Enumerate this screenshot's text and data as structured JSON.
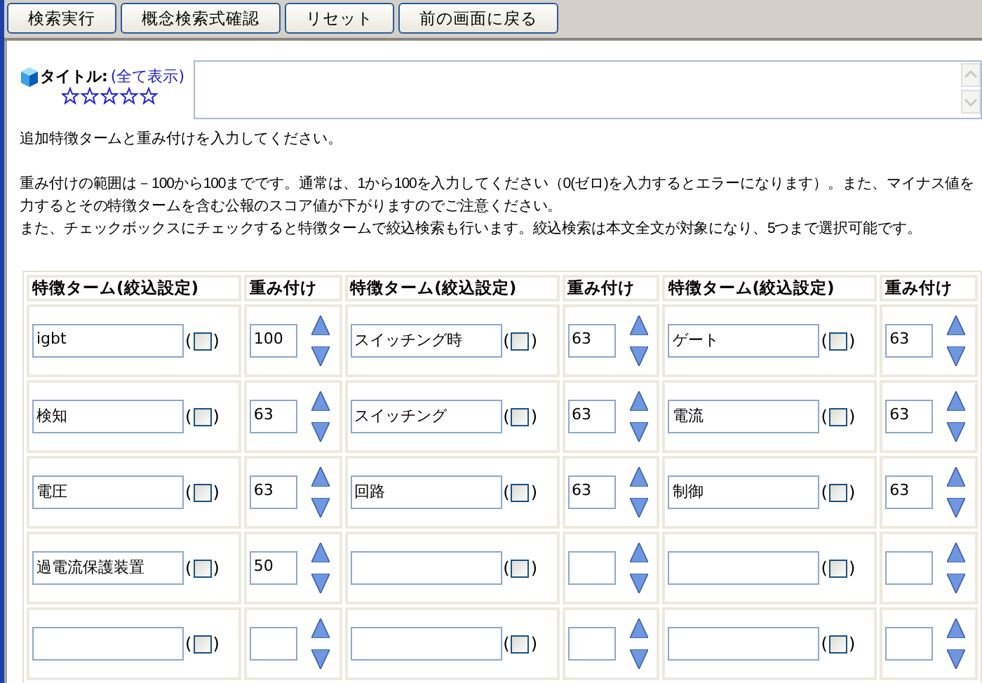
{
  "toolbar": {
    "buttons": [
      "検索実行",
      "概念検索式確認",
      "リセット",
      "前の画面に戻る"
    ]
  },
  "title_row": {
    "label": "タイトル:",
    "link": "(全て表示)",
    "stars": 0
  },
  "instructions": [
    "追加特徴タームと重み付けを入力してください。",
    "重み付けの範囲は－100から100までです。通常は、1から100を入力してください（0(ゼロ)を入力するとエラーになります）。また、マイナス値を",
    "力するとその特徴タームを含む公報のスコア値が下がりますのでご注意ください。",
    "また、チェックボックスにチェックすると特徴タームで絞込検索も行います。絞込検索は本文全文が対象になり、5つまで選択可能です。"
  ],
  "table": {
    "columns": [
      "特徴ターム(絞込設定)",
      "重み付け",
      "特徴ターム(絞込設定)",
      "重み付け",
      "特徴ターム(絞込設定)",
      "重み付け"
    ],
    "rows": [
      {
        "cells": [
          {
            "kind": "term",
            "term": "igbt",
            "open": "(",
            "checked": false,
            "close": ")"
          },
          {
            "kind": "weight",
            "weight": "100"
          },
          {
            "kind": "term",
            "term": "スイッチング時",
            "open": "(",
            "checked": false,
            "close": ")"
          },
          {
            "kind": "weight",
            "weight": "63"
          },
          {
            "kind": "term",
            "term": "ゲート",
            "open": "(",
            "checked": false,
            "close": ")"
          },
          {
            "kind": "weight",
            "weight": "63"
          }
        ]
      },
      {
        "cells": [
          {
            "kind": "term",
            "term": "検知",
            "open": "(",
            "checked": false,
            "close": ")"
          },
          {
            "kind": "weight",
            "weight": "63"
          },
          {
            "kind": "term",
            "term": "スイッチング",
            "open": "(",
            "checked": false,
            "close": ")"
          },
          {
            "kind": "weight",
            "weight": "63"
          },
          {
            "kind": "term",
            "term": "電流",
            "open": "(",
            "checked": false,
            "close": ")"
          },
          {
            "kind": "weight",
            "weight": "63"
          }
        ]
      },
      {
        "cells": [
          {
            "kind": "term",
            "term": "電圧",
            "open": "(",
            "checked": false,
            "close": ")"
          },
          {
            "kind": "weight",
            "weight": "63"
          },
          {
            "kind": "term",
            "term": "回路",
            "open": "(",
            "checked": false,
            "close": ")"
          },
          {
            "kind": "weight",
            "weight": "63"
          },
          {
            "kind": "term",
            "term": "制御",
            "open": "(",
            "checked": false,
            "close": ")"
          },
          {
            "kind": "weight",
            "weight": "63"
          }
        ]
      },
      {
        "cells": [
          {
            "kind": "term",
            "term": "過電流保護装置",
            "open": "(",
            "checked": false,
            "close": ")"
          },
          {
            "kind": "weight",
            "weight": "50"
          },
          {
            "kind": "term",
            "open": "(",
            "checked": false,
            "close": ")"
          },
          {
            "kind": "weight"
          },
          {
            "kind": "term",
            "open": "(",
            "checked": false,
            "close": ")"
          },
          {
            "kind": "weight"
          }
        ]
      },
      {
        "cells": [
          {
            "kind": "term",
            "open": "(",
            "checked": false,
            "close": ")"
          },
          {
            "kind": "weight"
          },
          {
            "kind": "term",
            "open": "(",
            "checked": false,
            "close": ")"
          },
          {
            "kind": "weight"
          },
          {
            "kind": "term",
            "open": "(",
            "checked": false,
            "close": ")"
          },
          {
            "kind": "weight"
          }
        ]
      }
    ]
  }
}
